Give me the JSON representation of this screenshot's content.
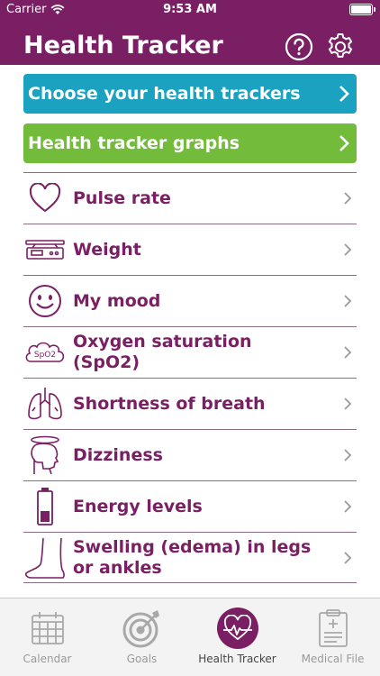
{
  "status_bar": {
    "carrier": "Carrier",
    "time": "9:53 AM"
  },
  "header": {
    "title": "Health Tracker"
  },
  "actions": {
    "choose_trackers": "Choose your health trackers",
    "tracker_graphs": "Health tracker graphs"
  },
  "trackers": [
    {
      "label": "Pulse rate",
      "icon": "heart-icon"
    },
    {
      "label": "Weight",
      "icon": "scale-icon"
    },
    {
      "label": "My mood",
      "icon": "smiley-icon"
    },
    {
      "label": "Oxygen saturation (SpO2)",
      "icon": "spo2-icon",
      "icon_text": "SpO2"
    },
    {
      "label": "Shortness of breath",
      "icon": "lungs-icon"
    },
    {
      "label": "Dizziness",
      "icon": "dizzy-head-icon"
    },
    {
      "label": "Energy levels",
      "icon": "battery-icon"
    },
    {
      "label": "Swelling (edema) in legs or ankles",
      "icon": "leg-icon"
    }
  ],
  "tabs": [
    {
      "label": "Calendar",
      "icon": "calendar-icon",
      "active": false
    },
    {
      "label": "Goals",
      "icon": "target-icon",
      "active": false
    },
    {
      "label": "Health Tracker",
      "icon": "heart-pulse-icon",
      "active": true
    },
    {
      "label": "Medical File",
      "icon": "clipboard-icon",
      "active": false
    }
  ],
  "colors": {
    "brand_purple": "#7a1f63",
    "choose_button": "#1aa2c0",
    "graphs_button": "#73bb3b",
    "tabbar_bg": "#f3f3f3"
  }
}
